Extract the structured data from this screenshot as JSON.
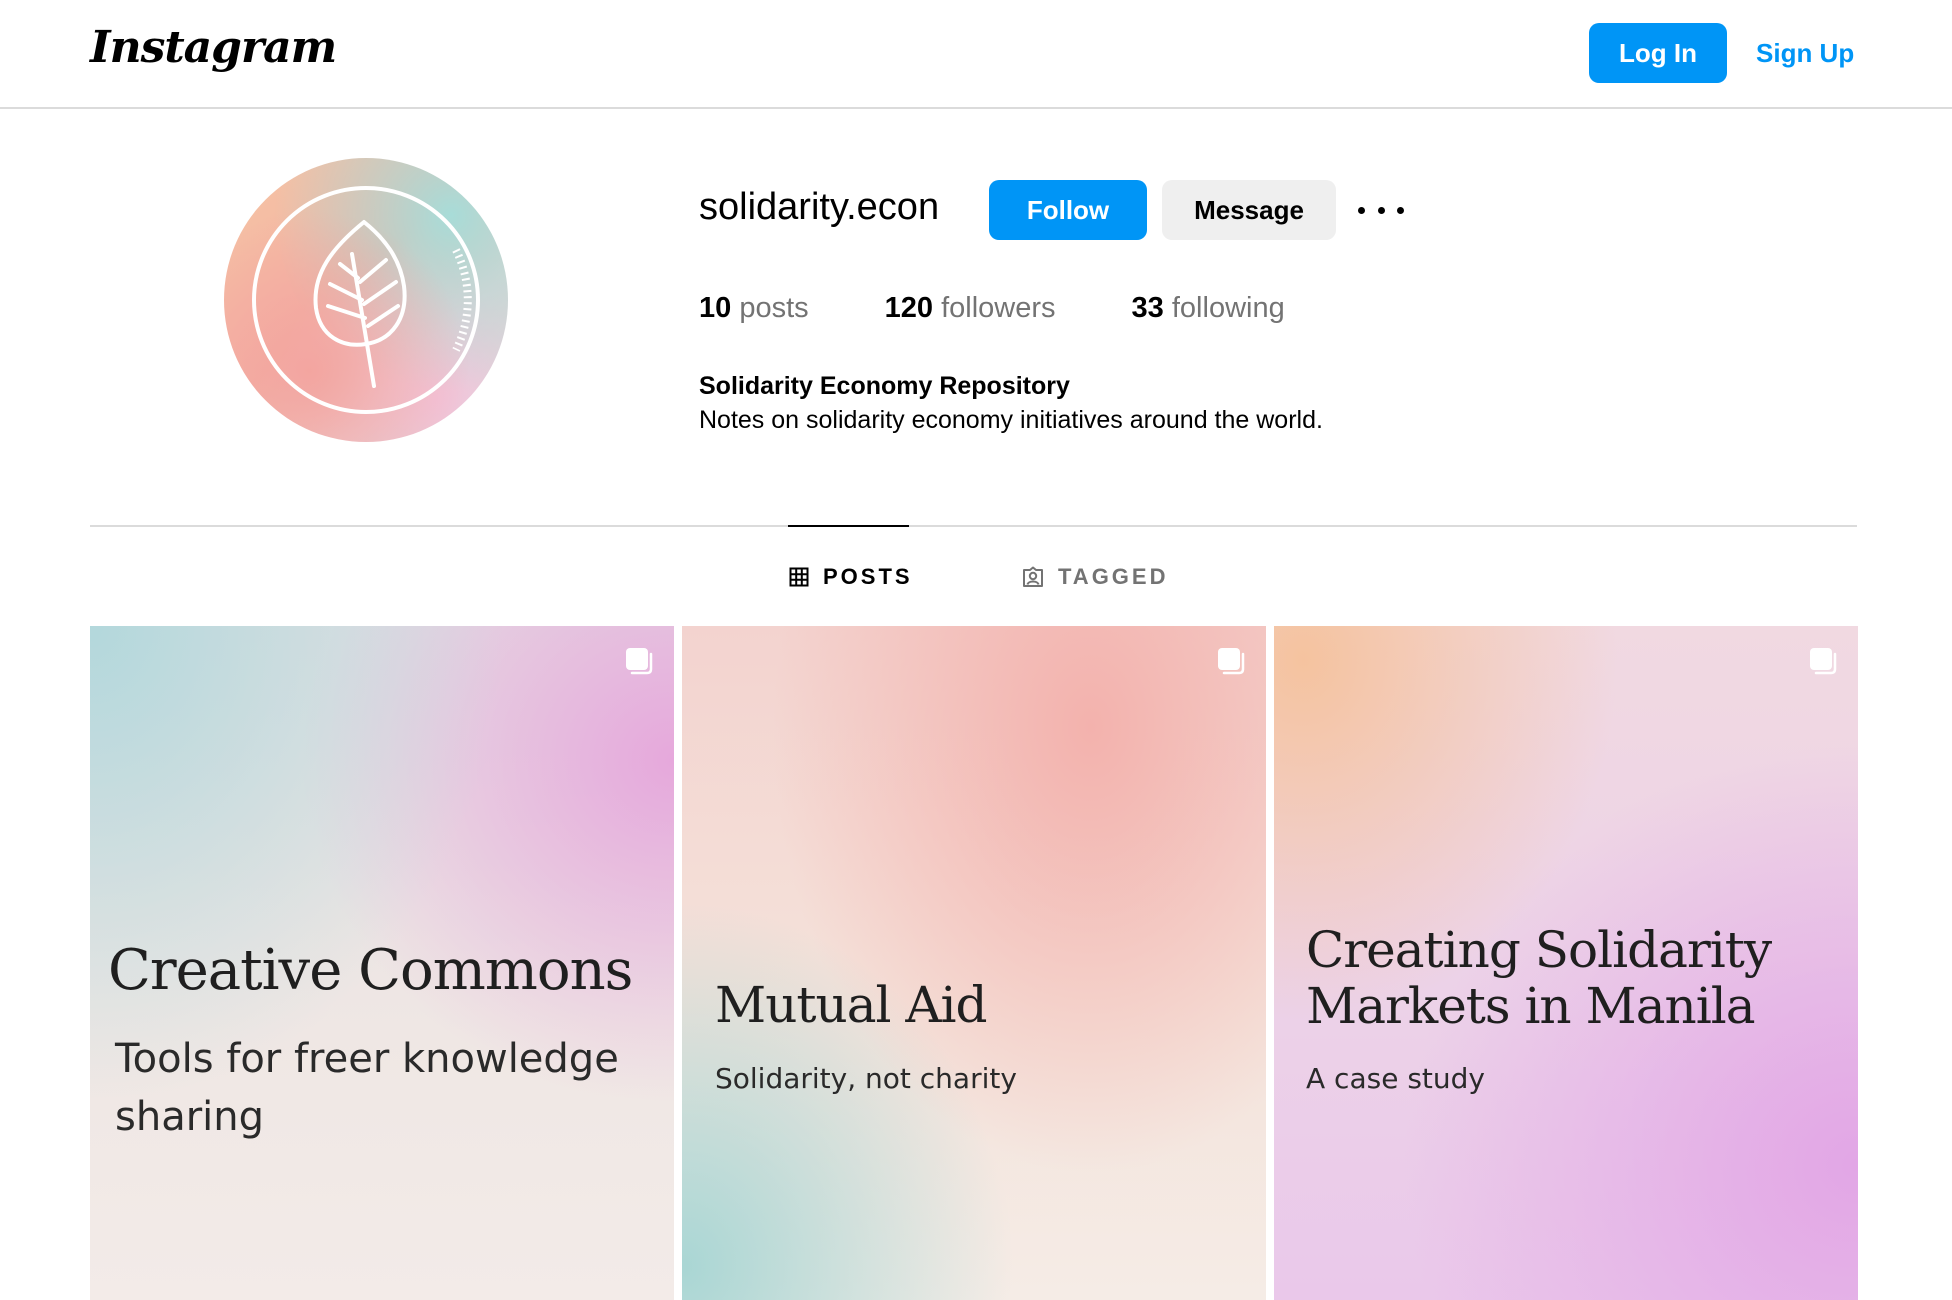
{
  "nav": {
    "logo": "Instagram",
    "login_label": "Log In",
    "signup_label": "Sign Up",
    "accent_color": "#0095f6"
  },
  "profile": {
    "username": "solidarity.econ",
    "follow_label": "Follow",
    "message_label": "Message",
    "more_icon": "more-horizontal-icon",
    "avatar_icon": "leaf-icon",
    "stats": [
      {
        "count": "10",
        "label": "posts"
      },
      {
        "count": "120",
        "label": "followers"
      },
      {
        "count": "33",
        "label": "following"
      }
    ],
    "full_name": "Solidarity Economy Repository",
    "bio": "Notes on solidarity economy initiatives around the world."
  },
  "tabs": [
    {
      "label": "POSTS",
      "icon": "grid-icon",
      "active": true
    },
    {
      "label": "TAGGED",
      "icon": "tagged-icon",
      "active": false
    }
  ],
  "posts": [
    {
      "title": "Creative Commons",
      "subtitle": "Tools for freer knowledge sharing",
      "icon": "carousel-icon"
    },
    {
      "title": "Mutual Aid",
      "subtitle": "Solidarity, not charity",
      "icon": "carousel-icon"
    },
    {
      "title": "Creating Solidarity Markets in Manila",
      "subtitle": "A case study",
      "icon": "carousel-icon"
    }
  ]
}
